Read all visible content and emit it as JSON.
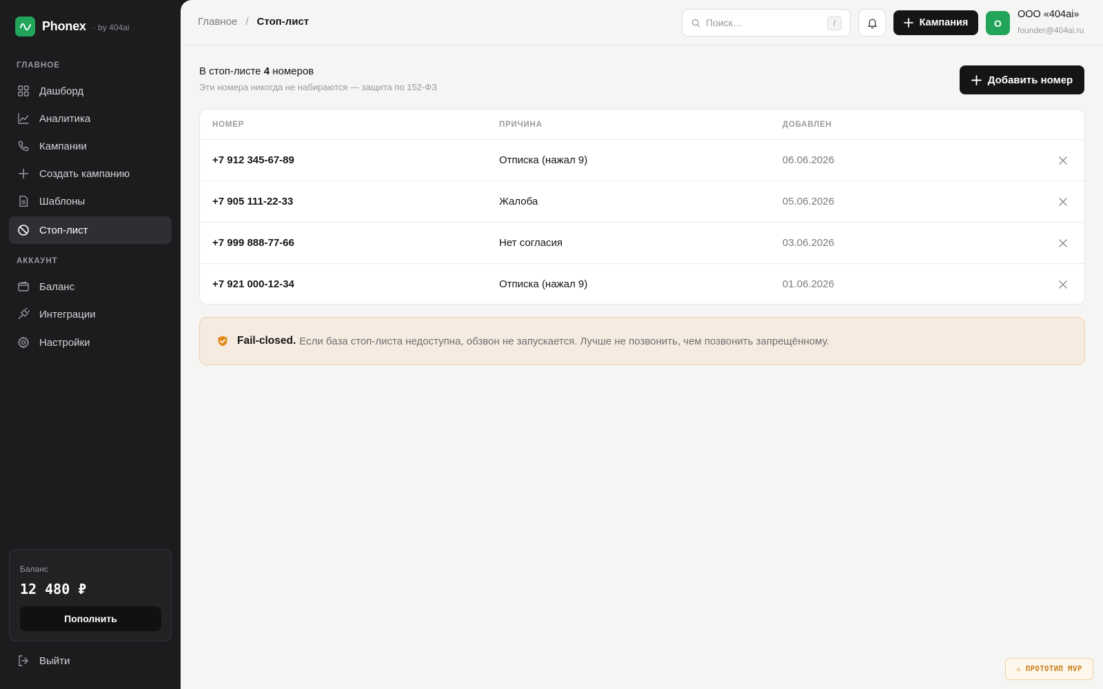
{
  "brand": {
    "name": "Phonex",
    "by": "· by 404ai"
  },
  "sidebar": {
    "section_main": "ГЛАВНОЕ",
    "section_account": "АККАУНТ",
    "items": [
      {
        "label": "Дашборд",
        "icon": "dashboard-icon"
      },
      {
        "label": "Аналитика",
        "icon": "chart-line-icon"
      },
      {
        "label": "Кампании",
        "icon": "phone-icon"
      },
      {
        "label": "Создать кампанию",
        "icon": "plus-icon"
      },
      {
        "label": "Шаблоны",
        "icon": "document-icon"
      },
      {
        "label": "Стоп-лист",
        "icon": "ban-icon",
        "active": true
      }
    ],
    "account_items": [
      {
        "label": "Баланс",
        "icon": "wallet-icon"
      },
      {
        "label": "Интеграции",
        "icon": "plug-icon"
      },
      {
        "label": "Настройки",
        "icon": "gear-icon"
      }
    ],
    "balance": {
      "label": "Баланс",
      "value": "12 480 ₽",
      "topup": "Пополнить"
    },
    "logout": "Выйти"
  },
  "topbar": {
    "breadcrumb_root": "Главное",
    "breadcrumb_sep": "/",
    "breadcrumb_current": "Стоп-лист",
    "search_placeholder": "Поиск…",
    "search_shortcut": "/",
    "campaign_button": "Кампания",
    "avatar_letter": "О",
    "org_name": "ООО «404ai»",
    "org_email": "founder@404ai.ru"
  },
  "main": {
    "summary_prefix": "В стоп-листе",
    "summary_count": "4",
    "summary_suffix": "номеров",
    "subtitle": "Эти номера никогда не набираются — защита по 152-ФЗ",
    "add_button": "Добавить номер",
    "columns": [
      "НОМЕР",
      "ПРИЧИНА",
      "ДОБАВЛЕН"
    ],
    "rows": [
      {
        "number": "+7 912 345-67-89",
        "reason": "Отписка (нажал 9)",
        "date": "06.06.2026"
      },
      {
        "number": "+7 905 111-22-33",
        "reason": "Жалоба",
        "date": "05.06.2026"
      },
      {
        "number": "+7 999 888-77-66",
        "reason": "Нет согласия",
        "date": "03.06.2026"
      },
      {
        "number": "+7 921 000-12-34",
        "reason": "Отписка (нажал 9)",
        "date": "01.06.2026"
      }
    ],
    "notice_title": "Fail-closed.",
    "notice_text": "Если база стоп-листа недоступна, обзвон не запускается. Лучше не позвонить, чем позвонить запрещённому."
  },
  "badge": "⚠ ПРОТОТИП MVP",
  "colors": {
    "accent_green": "#22a45a",
    "sidebar_bg": "#1c1c1e",
    "notice_bg": "#f6ebe1",
    "warning_orange": "#c57a12"
  }
}
